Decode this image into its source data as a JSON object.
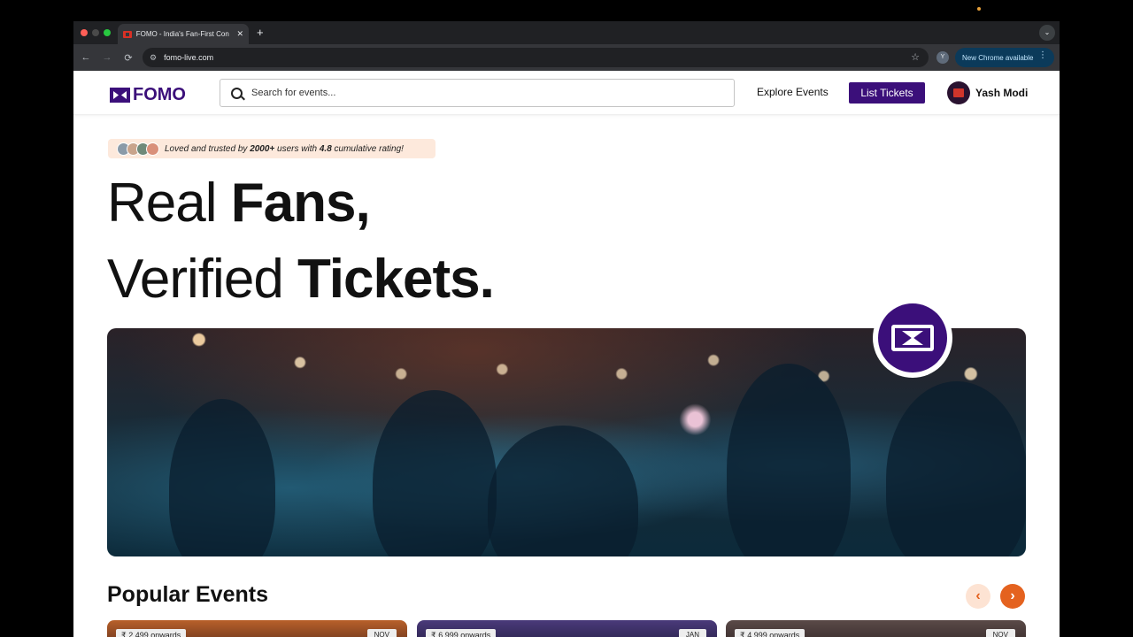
{
  "browser": {
    "tab_title": "FOMO - India's Fan-First Con",
    "tab_close": "✕",
    "new_tab": "+",
    "url": "fomo-live.com",
    "profile_initial": "Y",
    "update_label": "New Chrome available",
    "update_menu": "⋮",
    "back": "←",
    "forward": "→",
    "reload": "⟳",
    "star": "☆",
    "tune": "⚙",
    "tab_menu": "⌄"
  },
  "header": {
    "logo_text": "FOMO",
    "search_placeholder": "Search for events...",
    "explore_label": "Explore Events",
    "list_tickets_label": "List Tickets",
    "user_name": "Yash Modi"
  },
  "hero": {
    "badge_text_prefix": "Loved and trusted by ",
    "badge_users": "2000+",
    "badge_text_mid": " users with ",
    "badge_rating": "4.8",
    "badge_text_suffix": " cumulative rating!",
    "line1_regular": "Real ",
    "line1_bold": "Fans,",
    "line2_regular": "Verified ",
    "line2_bold": "Tickets."
  },
  "popular": {
    "title": "Popular Events",
    "prev": "‹",
    "next": "›",
    "cards": [
      {
        "price": "₹ 2,499 onwards",
        "month": "NOV"
      },
      {
        "price": "₹ 6,999 onwards",
        "month": "JAN"
      },
      {
        "price": "₹ 4,999 onwards",
        "month": "NOV"
      }
    ]
  },
  "colors": {
    "brand": "#3b0f7a",
    "accent": "#e4621f",
    "badge_bg": "#fde9dc"
  }
}
